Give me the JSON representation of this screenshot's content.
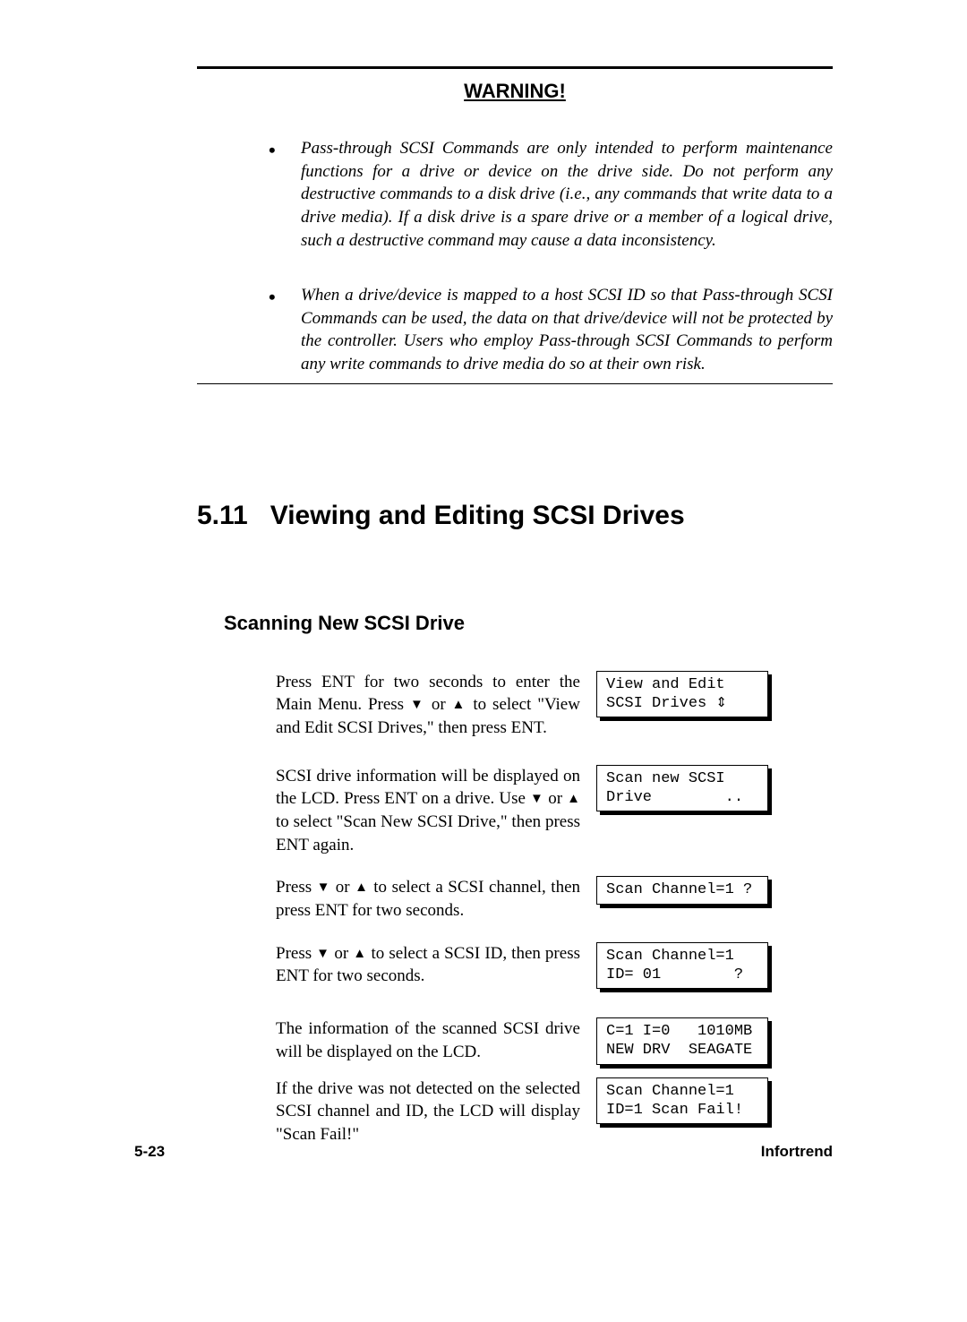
{
  "warning_title": "WARNING!",
  "warnings": [
    "Pass-through SCSI Commands are only intended to perform maintenance functions for a drive or device on the drive side. Do not perform any destructive commands to a disk drive (i.e., any commands that write data to a drive media). If a disk drive is a spare drive or a member of a logical drive, such a destructive command may cause a data inconsistency.",
    "When a drive/device is mapped to a host SCSI ID so that Pass-through SCSI Commands can be used, the data on that drive/device will not be protected by the controller.  Users who employ Pass-through SCSI Commands to perform any write commands to drive media do so at their own risk."
  ],
  "section_number": "5.11",
  "section_title": "Viewing and Editing SCSI Drives",
  "subsection_title": "Scanning New SCSI Drive",
  "steps": {
    "s1a": "Press ENT for two seconds to enter the Main Menu. Press ",
    "s1b": " or ",
    "s1c": " to select \"View and Edit SCSI Drives,\" then press ENT.",
    "s2a": "SCSI drive information will be displayed on the LCD. Press ENT on a drive. Use ",
    "s2b": " or ",
    "s2c": " to select \"Scan New SCSI Drive,\" then press ENT again.",
    "s3a": "Press ",
    "s3b": " or ",
    "s3c": " to select a SCSI channel, then press ENT for two seconds.",
    "s4a": "Press ",
    "s4b": " or ",
    "s4c": " to select a SCSI ID, then press ENT for two seconds.",
    "s5": "The information of the scanned SCSI drive will be displayed on the LCD.",
    "s6": "If the drive was not detected on the selected SCSI channel and ID, the LCD will display \"Scan Fail!\""
  },
  "lcd": {
    "l1_line1": "View and Edit",
    "l1_line2a": "SCSI Drives ",
    "updown": "⇕",
    "l2_line1": "Scan new SCSI",
    "l2_line2": "Drive        ..",
    "l3": "Scan Channel=1 ?",
    "l4_line1": "Scan Channel=1",
    "l4_line2": "ID= 01        ?",
    "l5_line1": "C=1 I=0   1010MB",
    "l5_line2": "NEW DRV  SEAGATE",
    "l6_line1": "Scan Channel=1",
    "l6_line2": "ID=1 Scan Fail!"
  },
  "triangles": {
    "down": "▼",
    "up": "▲"
  },
  "footer": {
    "page": "5-23",
    "brand": "Infortrend"
  }
}
